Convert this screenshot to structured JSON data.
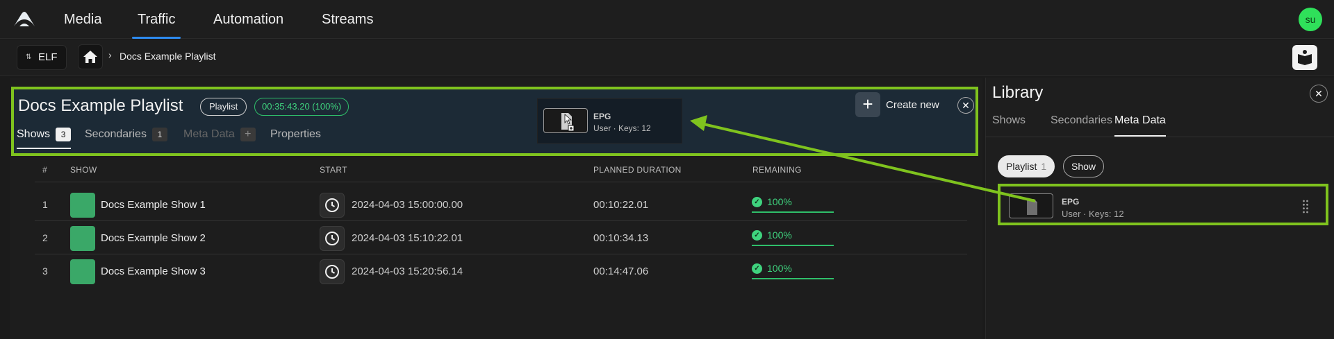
{
  "nav": {
    "items": [
      {
        "label": "Media",
        "active": false
      },
      {
        "label": "Traffic",
        "active": true
      },
      {
        "label": "Automation",
        "active": false
      },
      {
        "label": "Streams",
        "active": false
      }
    ],
    "avatar": "su"
  },
  "breadcrumb": {
    "environment": "ELF",
    "current": "Docs Example Playlist"
  },
  "playlist": {
    "title": "Docs Example Playlist",
    "type_badge": "Playlist",
    "duration_badge": "00:35:43.20 (100%)",
    "tabs": [
      {
        "label": "Shows",
        "count": "3"
      },
      {
        "label": "Secondaries",
        "count": "1"
      },
      {
        "label": "Meta Data",
        "count": "+"
      },
      {
        "label": "Properties",
        "count": ""
      }
    ],
    "create_label": "Create new"
  },
  "drag_ghost": {
    "name": "EPG",
    "meta": "User · Keys: 12"
  },
  "table": {
    "headers": [
      "#",
      "SHOW",
      "START",
      "PLANNED DURATION",
      "REMAINING"
    ],
    "rows": [
      {
        "num": "1",
        "name": "Docs Example Show 1",
        "start": "2024-04-03 15:00:00.00",
        "duration": "00:10:22.01",
        "remaining": "100%"
      },
      {
        "num": "2",
        "name": "Docs Example Show 2",
        "start": "2024-04-03 15:10:22.01",
        "duration": "00:10:34.13",
        "remaining": "100%"
      },
      {
        "num": "3",
        "name": "Docs Example Show 3",
        "start": "2024-04-03 15:20:56.14",
        "duration": "00:14:47.06",
        "remaining": "100%"
      }
    ]
  },
  "library": {
    "title": "Library",
    "tabs": [
      {
        "label": "Shows",
        "active": false
      },
      {
        "label": "Secondaries",
        "active": false
      },
      {
        "label": "Meta Data",
        "active": true
      }
    ],
    "filters": [
      {
        "label": "Playlist",
        "count": "1",
        "selected": true
      },
      {
        "label": "Show",
        "count": "",
        "selected": false
      }
    ],
    "item": {
      "name": "EPG",
      "meta": "User · Keys: 12"
    }
  },
  "colors": {
    "accent_nav": "#2d8bf0",
    "highlight": "#7fc31e",
    "success": "#3fd37e",
    "avatar": "#2fe05a"
  }
}
